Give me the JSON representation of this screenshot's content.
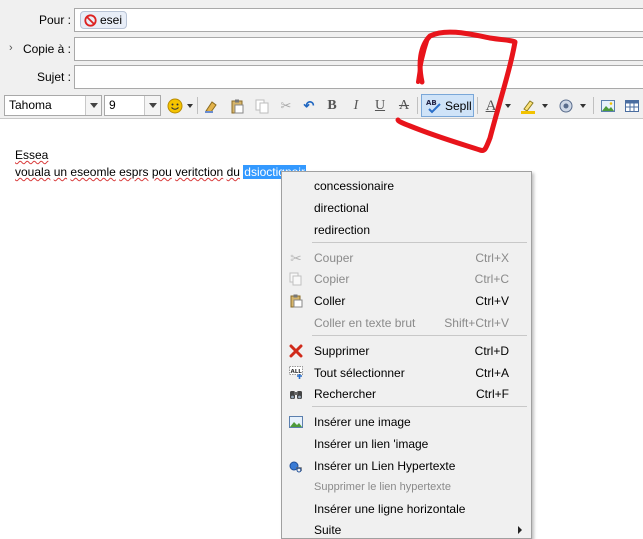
{
  "header": {
    "to_label": "Pour :",
    "to_recipient": "esei",
    "cc_label": "Copie à :",
    "subject_label": "Sujet :",
    "subject_value": ""
  },
  "toolbar": {
    "font_name": "Tahoma",
    "font_size": "9",
    "spell_label": "Sepll"
  },
  "editor": {
    "line1": "Essea",
    "line2_words": [
      "vouala",
      "un",
      "eseomle",
      "esprs",
      "pou",
      "veritction",
      "du"
    ],
    "selected_word": "dsioctiqnoir"
  },
  "context_menu": {
    "suggestions": [
      "concessionaire",
      "directional",
      "redirection"
    ],
    "edit_items": [
      {
        "label": "Couper",
        "shortcut": "Ctrl+X",
        "icon": "scissors-icon",
        "enabled": false
      },
      {
        "label": "Copier",
        "shortcut": "Ctrl+C",
        "icon": "copy-icon",
        "enabled": false
      },
      {
        "label": "Coller",
        "shortcut": "Ctrl+V",
        "icon": "paste-icon",
        "enabled": true
      },
      {
        "label": "Coller en texte brut",
        "shortcut": "Shift+Ctrl+V",
        "icon": "",
        "enabled": false
      }
    ],
    "action_items": [
      {
        "label": "Supprimer",
        "shortcut": "Ctrl+D",
        "icon": "delete-x-icon",
        "enabled": true
      },
      {
        "label": "Tout sélectionner",
        "shortcut": "Ctrl+A",
        "icon": "select-all-icon",
        "enabled": true
      },
      {
        "label": "Rechercher",
        "shortcut": "Ctrl+F",
        "icon": "binoculars-icon",
        "enabled": true
      }
    ],
    "insert_items": [
      {
        "label": "Insérer une image",
        "icon": "image-icon",
        "enabled": true
      },
      {
        "label": "Insérer un lien 'image",
        "icon": "",
        "enabled": true
      },
      {
        "label": "Insérer un Lien Hypertexte",
        "icon": "hyperlink-icon",
        "enabled": true
      },
      {
        "label": "Supprimer le lien hypertexte",
        "icon": "",
        "enabled": false
      },
      {
        "label": "Insérer une ligne horizontale",
        "icon": "",
        "enabled": true
      },
      {
        "label": "Suite",
        "icon": "",
        "enabled": true
      }
    ]
  },
  "colors": {
    "selection": "#3399ff",
    "spell_highlight": "#cfe3f8",
    "annotation": "#e8141b",
    "misspell_underline": "#d83a3a"
  }
}
